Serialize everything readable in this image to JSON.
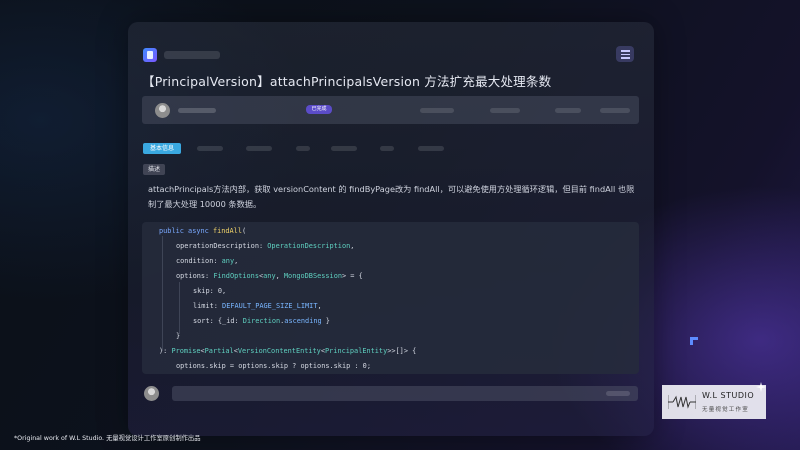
{
  "issue": {
    "title": "【PrincipalVersion】attachPrincipalsVersion 方法扩充最大处理条数",
    "status": "已完成"
  },
  "section": {
    "tag": "基本信息",
    "description_label": "描述",
    "description": "attachPrincipals方法内部，获取 versionContent 的 findByPage改为 findAll，可以避免使用方处理循环逻辑，但目前 findAll 也限制了最大处理 10000 条数据。"
  },
  "code": {
    "lines": [
      [
        [
          "public async ",
          "kw"
        ],
        [
          "findAll",
          "fn"
        ],
        [
          "(",
          "pu"
        ]
      ],
      [
        [
          "operationDescription: ",
          "pu"
        ],
        [
          "OperationDescription",
          "ty"
        ],
        [
          ",",
          "pu"
        ]
      ],
      [
        [
          "condition: ",
          "pu"
        ],
        [
          "any",
          "ty"
        ],
        [
          ",",
          "pu"
        ]
      ],
      [
        [
          "options: ",
          "pu"
        ],
        [
          "FindOptions",
          "ty"
        ],
        [
          "<",
          "pu"
        ],
        [
          "any",
          "ty"
        ],
        [
          ", ",
          "pu"
        ],
        [
          "MongoDBSession",
          "ty"
        ],
        [
          "> = {",
          "pu"
        ]
      ],
      [
        [
          "skip: 0,",
          "pu"
        ]
      ],
      [
        [
          "limit: ",
          "pu"
        ],
        [
          "DEFAULT_PAGE_SIZE_LIMIT",
          "cn"
        ],
        [
          ",",
          "pu"
        ]
      ],
      [
        [
          "sort: {_id: ",
          "pu"
        ],
        [
          "Direction",
          "ty"
        ],
        [
          ".",
          "pu"
        ],
        [
          "ascending",
          "cn"
        ],
        [
          " }",
          "pu"
        ]
      ],
      [
        [
          "}",
          "pu"
        ]
      ],
      [
        [
          "): ",
          "pu"
        ],
        [
          "Promise",
          "ty"
        ],
        [
          "<",
          "pu"
        ],
        [
          "Partial",
          "ty"
        ],
        [
          "<",
          "pu"
        ],
        [
          "VersionContentEntity",
          "ty"
        ],
        [
          "<",
          "pu"
        ],
        [
          "PrincipalEntity",
          "ty"
        ],
        [
          ">>[]> {",
          "pu"
        ]
      ],
      [
        [
          "options.skip = options.skip ? options.skip : 0;",
          "pu"
        ]
      ]
    ],
    "colors": {
      "kw": "#7aa9ff",
      "fn": "#f0d36a",
      "ty": "#5fd0c0",
      "cn": "#79b6ff",
      "pu": "#d4d8e2"
    }
  },
  "logo": {
    "text": "W.L STUDIO",
    "subtext": "无量视觉工作室"
  },
  "footer": {
    "credit": "*Original work of  W.L Studio. 无量视觉设计工作室原创制作出品"
  },
  "icons": [
    "app-icon",
    "menu-icon",
    "avatar",
    "corner-bracket-icon",
    "logo-mark",
    "star-icon"
  ],
  "colors": {
    "accent": "#5b4cc8",
    "tag": "#3aa8e0",
    "brand": "#5d8cff"
  }
}
